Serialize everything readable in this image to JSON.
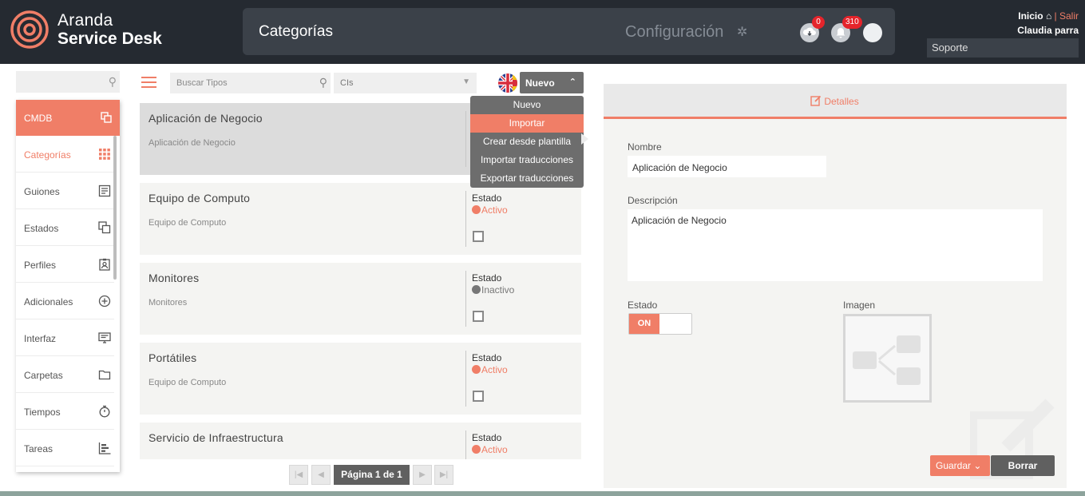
{
  "brand": {
    "line1": "Aranda",
    "line2": "Service Desk"
  },
  "header": {
    "title": "Categorías",
    "config": "Configuración",
    "download_badge": "0",
    "notifications_badge": "310",
    "inicio": "Inicio",
    "salir": "Salir",
    "user": "Claudia parra",
    "soporte": "Soporte"
  },
  "sidebar": {
    "header": "CMDB",
    "items": [
      {
        "label": "Categorías",
        "icon": "grid-icon"
      },
      {
        "label": "Guiones",
        "icon": "document-icon"
      },
      {
        "label": "Estados",
        "icon": "copy-icon"
      },
      {
        "label": "Perfiles",
        "icon": "profile-icon"
      },
      {
        "label": "Adicionales",
        "icon": "plus-circle-icon"
      },
      {
        "label": "Interfaz",
        "icon": "monitor-icon"
      },
      {
        "label": "Carpetas",
        "icon": "folder-icon"
      },
      {
        "label": "Tiempos",
        "icon": "stopwatch-icon"
      },
      {
        "label": "Tareas",
        "icon": "tasks-icon"
      }
    ]
  },
  "toolbar": {
    "search_placeholder": "Buscar Tipos",
    "ci_select": "CIs",
    "nuevo_label": "Nuevo"
  },
  "dropdown": {
    "items": [
      "Nuevo",
      "Importar",
      "Crear desde plantilla",
      "Importar traducciones",
      "Exportar traducciones"
    ]
  },
  "cards": [
    {
      "name": "Aplicación de Negocio",
      "desc": "Aplicación de Negocio",
      "estado_label": "",
      "estado": ""
    },
    {
      "name": "Equipo de Computo",
      "desc": "Equipo de Computo",
      "estado_label": "Estado",
      "estado": "Activo"
    },
    {
      "name": "Monitores",
      "desc": "Monitores",
      "estado_label": "Estado",
      "estado": "Inactivo"
    },
    {
      "name": "Portátiles",
      "desc": "Equipo de Computo",
      "estado_label": "Estado",
      "estado": "Activo"
    },
    {
      "name": "Servicio de Infraestructura",
      "desc": "",
      "estado_label": "Estado",
      "estado": "Activo"
    }
  ],
  "pager": {
    "label": "Página 1 de 1"
  },
  "detail": {
    "tab": "Detalles",
    "nombre_label": "Nombre",
    "nombre_value": "Aplicación de Negocio",
    "descripcion_label": "Descripción",
    "descripcion_value": "Aplicación de Negocio",
    "estado_label": "Estado",
    "toggle_on": "ON",
    "imagen_label": "Imagen",
    "guardar": "Guardar",
    "borrar": "Borrar"
  },
  "colors": {
    "accent": "#f07e67",
    "header_bg": "#252a31",
    "panel_bg": "#f4f4f2"
  }
}
